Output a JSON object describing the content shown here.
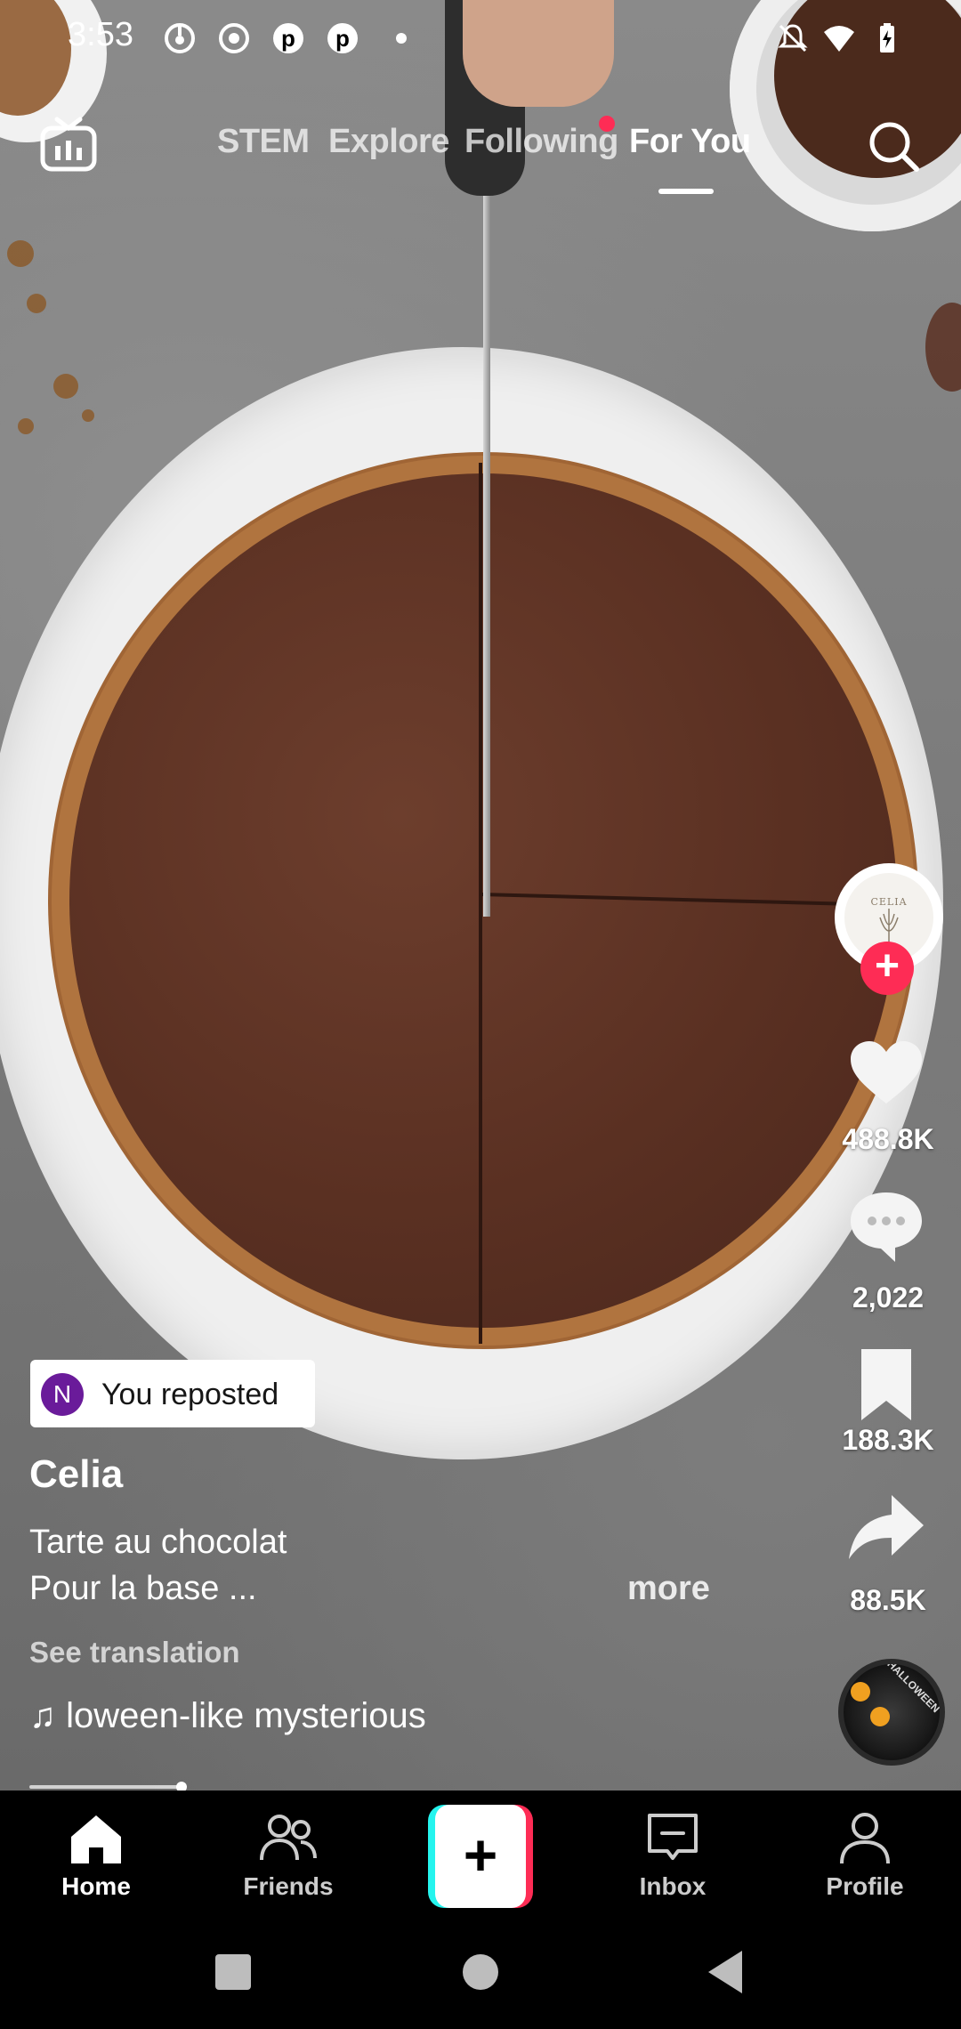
{
  "status_bar": {
    "time": "3:53"
  },
  "top_tabs": [
    {
      "label": "STEM"
    },
    {
      "label": "Explore"
    },
    {
      "label": "Following"
    },
    {
      "label": "For You"
    }
  ],
  "active_tab": "For You",
  "creator_avatar_text": "CELIA",
  "actions": {
    "likes": "488.8K",
    "comments": "2,022",
    "saves": "188.3K",
    "shares": "88.5K"
  },
  "repost": {
    "avatar_initial": "N",
    "label": "You reposted"
  },
  "post": {
    "username": "Celia",
    "caption_line1": "Tarte au chocolat",
    "caption_line2": "Pour la base ...",
    "more_label": "more",
    "translation_label": "See translation",
    "sound": "loween-like mysterious",
    "disc_label": "HALLOWEEN"
  },
  "progress": 0.16,
  "bottom_nav": [
    {
      "label": "Home"
    },
    {
      "label": "Friends"
    },
    {
      "label": "Inbox"
    },
    {
      "label": "Profile"
    }
  ],
  "create_label": "+",
  "colors": {
    "accent_red": "#fe2c55",
    "accent_cyan": "#25f4ee",
    "background": "#000000"
  },
  "icons": [
    "live-tv-icon",
    "search-icon",
    "heart-icon",
    "comment-icon",
    "bookmark-icon",
    "share-icon",
    "music-note-icon",
    "home-icon",
    "friends-icon",
    "inbox-icon",
    "profile-icon"
  ]
}
